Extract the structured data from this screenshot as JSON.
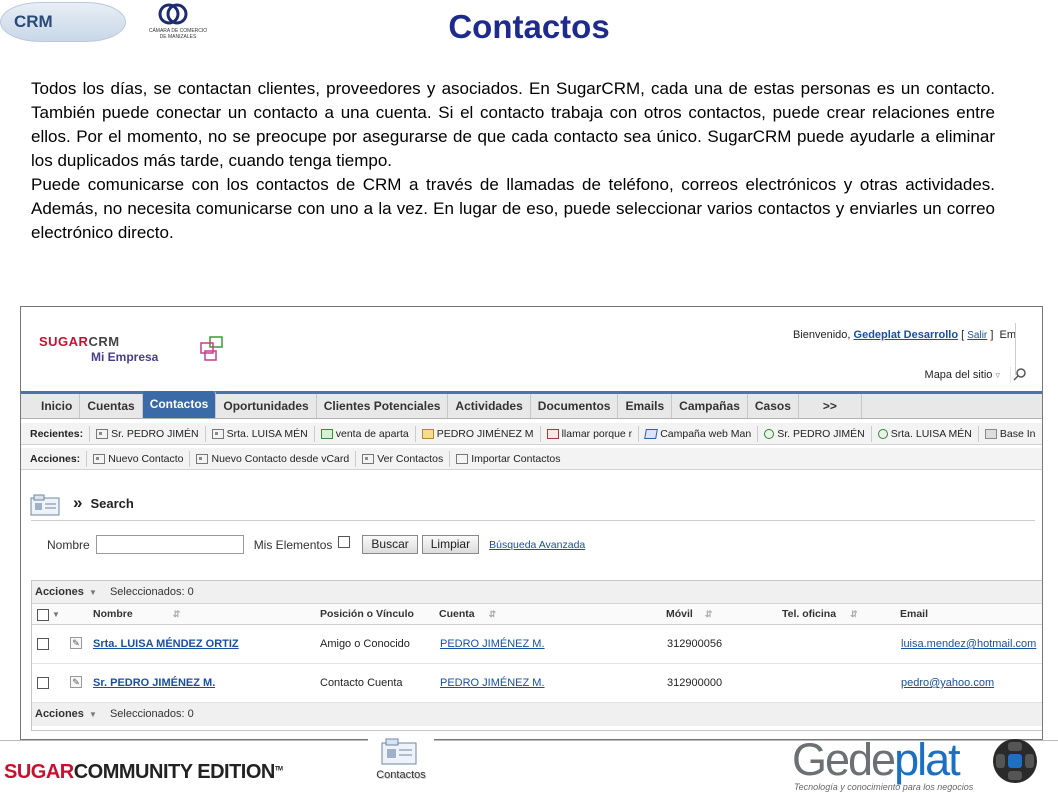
{
  "slide": {
    "logo_text": "CRM",
    "chamber_text": "CÁMARA DE COMERCIO DE MANIZALES",
    "title": "Contactos",
    "paragraphs": [
      "Todos los días, se contactan clientes, proveedores y asociados. En SugarCRM, cada una de estas personas es un contacto. También puede conectar un contacto a una cuenta. Si el contacto trabaja con otros contactos, puede crear relaciones entre ellos. Por el momento, no se preocupe por asegurarse de que cada contacto sea único. SugarCRM puede ayudarle a eliminar los duplicados más tarde, cuando tenga tiempo.",
      "Puede comunicarse con los contactos de CRM a través de llamadas de teléfono, correos electrónicos y otras actividades. Además, no necesita comunicarse con uno a la vez. En lugar de eso, puede seleccionar varios contactos y enviarles un correo electrónico directo."
    ]
  },
  "app": {
    "brand_sugar": "SUGAR",
    "brand_crm": "CRM",
    "company": "Mi Empresa",
    "welcome_prefix": "Bienvenido,",
    "user": "Gedeplat Desarrollo",
    "salir": "Salir",
    "cut_label": "Em",
    "mapa": "Mapa del sitio",
    "tabs": [
      "Inicio",
      "Cuentas",
      "Contactos",
      "Oportunidades",
      "Clientes Potenciales",
      "Actividades",
      "Documentos",
      "Emails",
      "Campañas",
      "Casos",
      ">>"
    ],
    "active_tab": "Contactos",
    "recent_label": "Recientes:",
    "recent": [
      {
        "label": "Sr. PEDRO JIMÉN",
        "icon": "contact-card-icon"
      },
      {
        "label": "Srta. LUISA MÉN",
        "icon": "contact-card-icon"
      },
      {
        "label": "venta de aparta",
        "icon": "money-icon"
      },
      {
        "label": "PEDRO JIMÉNEZ M",
        "icon": "folder-icon"
      },
      {
        "label": "llamar porque r",
        "icon": "mail-icon"
      },
      {
        "label": "Campaña web Man",
        "icon": "campaign-icon"
      },
      {
        "label": "Sr. PEDRO JIMÉN",
        "icon": "magnifier-icon"
      },
      {
        "label": "Srta. LUISA MÉN",
        "icon": "magnifier-icon"
      },
      {
        "label": "Base In",
        "icon": "wrench-icon"
      }
    ],
    "actions_label": "Acciones:",
    "actions": [
      "Nuevo Contacto",
      "Nuevo Contacto desde vCard",
      "Ver Contactos",
      "Importar Contactos"
    ],
    "search_title": "Search",
    "search_raquo": "»",
    "form": {
      "nombre_label": "Nombre",
      "nombre_value": "",
      "mis_elementos": "Mis Elementos",
      "buscar": "Buscar",
      "limpiar": "Limpiar",
      "avanzada": "Búsqueda Avanzada"
    },
    "list": {
      "acciones": "Acciones",
      "seleccionados": "Seleccionados: 0",
      "columns": [
        "Nombre",
        "Posición o Vínculo",
        "Cuenta",
        "Móvil",
        "Tel. oficina",
        "Email"
      ],
      "rows": [
        {
          "nombre": "Srta. LUISA MÉNDEZ ORTIZ",
          "posicion": "Amigo o Conocido",
          "cuenta": "PEDRO JIMÉNEZ M.",
          "movil": "312900056",
          "tel": "",
          "email": "luisa.mendez@hotmail.com"
        },
        {
          "nombre": "Sr. PEDRO JIMÉNEZ M.",
          "posicion": "Contacto Cuenta",
          "cuenta": "PEDRO JIMÉNEZ M.",
          "movil": "312900000",
          "tel": "",
          "email": "pedro@yahoo.com"
        }
      ]
    }
  },
  "footer": {
    "sugar": "SUGAR",
    "community": "COMMUNITY EDITION",
    "tm": "TM",
    "module_label": "Contactos",
    "gede": "Gede",
    "plat": "plat",
    "tagline": "Tecnología y conocimiento para los negocios"
  }
}
